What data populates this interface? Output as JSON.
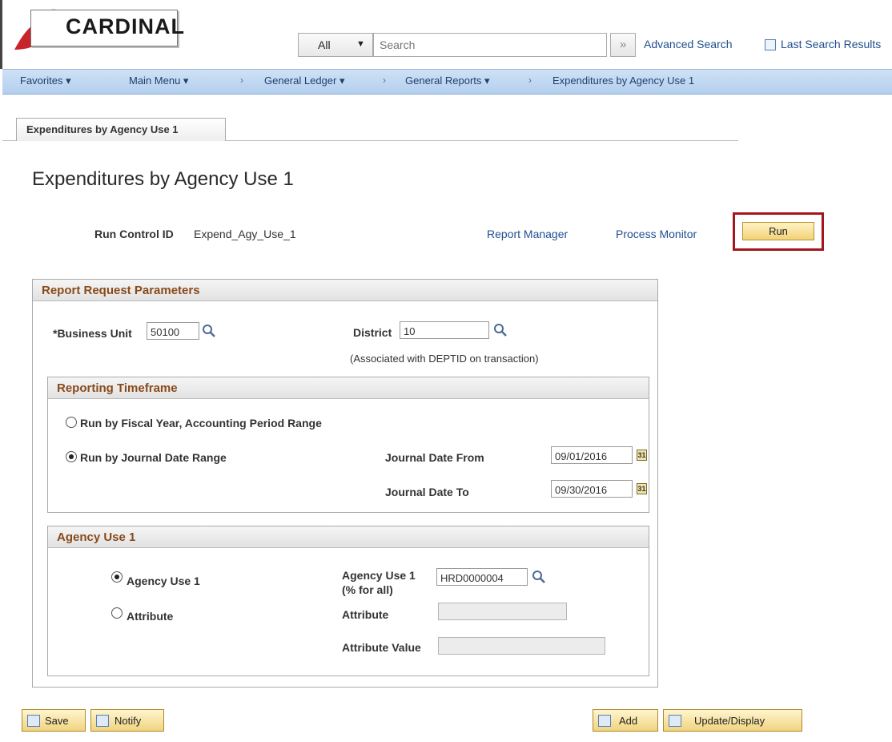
{
  "header": {
    "logo_text": "CARDINAL",
    "search_scope": "All",
    "search_placeholder": "Search",
    "advanced_search": "Advanced Search",
    "last_search_results": "Last Search Results"
  },
  "nav": {
    "favorites": "Favorites ▾",
    "main_menu": "Main Menu ▾",
    "general_ledger": "General Ledger ▾",
    "general_reports": "General Reports ▾",
    "current_page": "Expenditures by Agency Use 1",
    "separator": "›"
  },
  "tab": {
    "label": "Expenditures by Agency Use 1"
  },
  "page": {
    "title": "Expenditures by Agency Use 1",
    "run_control_label": "Run Control ID",
    "run_control_value": "Expend_Agy_Use_1",
    "report_manager": "Report Manager",
    "process_monitor": "Process Monitor",
    "run_button": "Run"
  },
  "report_params": {
    "header": "Report Request Parameters",
    "business_unit_label": "*Business Unit",
    "business_unit_value": "50100",
    "district_label": "District",
    "district_value": "10",
    "district_note": "(Associated with DEPTID on transaction)"
  },
  "timeframe": {
    "header": "Reporting Timeframe",
    "option_fiscal": "Run by Fiscal Year, Accounting Period Range",
    "option_journal": "Run by Journal Date Range",
    "selected": "journal",
    "date_from_label": "Journal Date From",
    "date_from_value": "09/01/2016",
    "date_to_label": "Journal Date To",
    "date_to_value": "09/30/2016"
  },
  "agency": {
    "header": "Agency Use 1",
    "option_agency": "Agency Use 1",
    "option_attribute": "Attribute",
    "selected": "agency",
    "agency_field_label_1": "Agency Use 1",
    "agency_field_label_2": "(% for all)",
    "agency_field_value": "HRD0000004",
    "attribute_label": "Attribute",
    "attribute_value": "",
    "attribute_value_label": "Attribute Value",
    "attribute_value_value": ""
  },
  "footer": {
    "save": "Save",
    "notify": "Notify",
    "add": "Add",
    "update_display": "Update/Display"
  },
  "colors": {
    "nav_bar": "#b4cfee",
    "group_header_text": "#8a4a1a",
    "link": "#1f4f8f",
    "run_highlight": "#a3161c",
    "button": "#f0d37e"
  }
}
